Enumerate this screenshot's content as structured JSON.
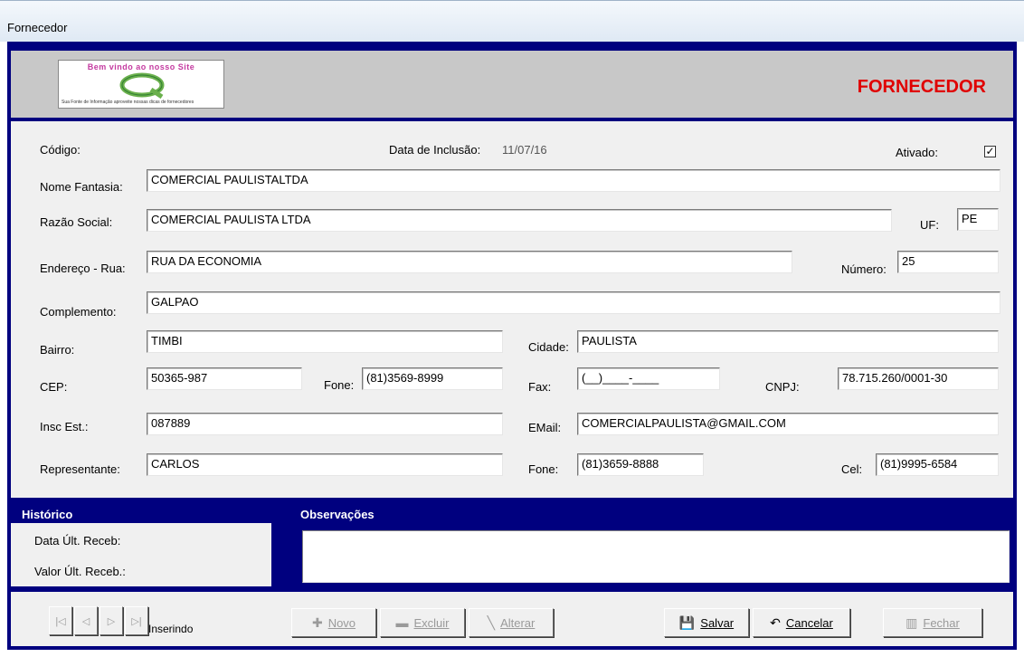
{
  "window": {
    "title": "Fornecedor"
  },
  "header": {
    "logo_text": "Bem vindo ao nosso Site",
    "logo_fine_print": "Sua Fonte de Informação aproveite nossas dicas de fornecedores",
    "page_title": "FORNECEDOR"
  },
  "form": {
    "codigo_label": "Código:",
    "data_inclusao_label": "Data de Inclusão:",
    "data_inclusao_value": "11/07/16",
    "ativado_label": "Ativado:",
    "ativado_checked": true,
    "nome_fantasia_label": "Nome Fantasia:",
    "nome_fantasia_value": "COMERCIAL PAULISTALTDA",
    "razao_social_label": "Razão Social:",
    "razao_social_value": "COMERCIAL PAULISTA LTDA",
    "uf_label": "UF:",
    "uf_value": "PE",
    "endereco_label": "Endereço - Rua:",
    "endereco_value": "RUA DA ECONOMIA",
    "numero_label": "Número:",
    "numero_value": "25",
    "complemento_label": "Complemento:",
    "complemento_value": "GALPAO",
    "bairro_label": "Bairro:",
    "bairro_value": "TIMBI",
    "cidade_label": "Cidade:",
    "cidade_value": "PAULISTA",
    "cep_label": "CEP:",
    "cep_value": "50365-987",
    "fone1_label": "Fone:",
    "fone1_value": "(81)3569-8999",
    "fax_label": "Fax:",
    "fax_value": "(__)____-____",
    "cnpj_label": "CNPJ:",
    "cnpj_value": "78.715.260/0001-30",
    "insc_est_label": "Insc Est.:",
    "insc_est_value": "087889",
    "email_label": "EMail:",
    "email_value": "COMERCIALPAULISTA@GMAIL.COM",
    "representante_label": "Representante:",
    "representante_value": "CARLOS",
    "fone2_label": "Fone:",
    "fone2_value": "(81)3659-8888",
    "cel_label": "Cel:",
    "cel_value": "(81)9995-6584"
  },
  "historico": {
    "title": "Histórico",
    "data_ult_receb_label": "Data Últ. Receb:",
    "valor_ult_receb_label": "Valor Últ. Receb.:"
  },
  "observacoes": {
    "title": "Observações",
    "value": ""
  },
  "toolbar": {
    "nav": {
      "first": "|◁",
      "prev": "◁",
      "next": "▷",
      "last": "▷|"
    },
    "status": "Inserindo",
    "novo": "Novo",
    "excluir": "Excluir",
    "alterar": "Alterar",
    "salvar": "Salvar",
    "cancelar": "Cancelar",
    "fechar": "Fechar"
  },
  "colors": {
    "frame": "#00007f",
    "title_red": "#e00000",
    "panel": "#f0f0f0"
  }
}
